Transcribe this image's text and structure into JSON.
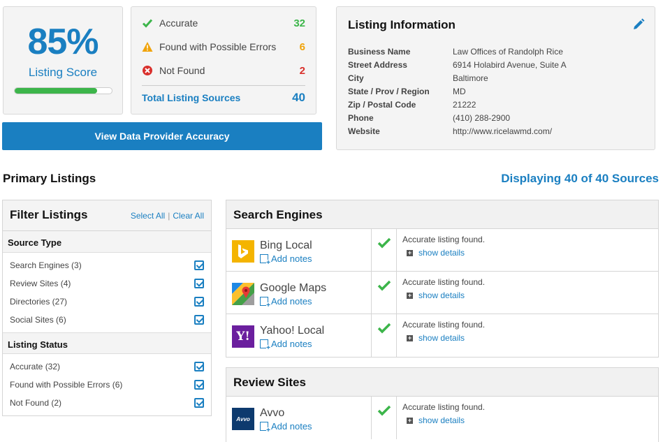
{
  "score": {
    "percent": "85%",
    "label": "Listing Score",
    "progress": 0.85
  },
  "counts": {
    "accurate": {
      "label": "Accurate",
      "value": "32",
      "color": "#3cb54a",
      "icon": "check-icon"
    },
    "errors": {
      "label": "Found with Possible Errors",
      "value": "6",
      "color": "#f0a30a",
      "icon": "warning-icon"
    },
    "not_found": {
      "label": "Not Found",
      "value": "2",
      "color": "#d9302c",
      "icon": "error-circle-icon"
    },
    "total": {
      "label": "Total Listing Sources",
      "value": "40"
    }
  },
  "provider_button": "View Data Provider Accuracy",
  "info": {
    "title": "Listing Information",
    "rows": [
      {
        "key": "Business Name",
        "value": "Law Offices of Randolph Rice"
      },
      {
        "key": "Street Address",
        "value": "6914 Holabird Avenue, Suite A"
      },
      {
        "key": "City",
        "value": "Baltimore"
      },
      {
        "key": "State / Prov / Region",
        "value": "MD"
      },
      {
        "key": "Zip / Postal Code",
        "value": "21222"
      },
      {
        "key": "Phone",
        "value": "(410) 288-2900"
      },
      {
        "key": "Website",
        "value": "http://www.ricelawmd.com/"
      }
    ]
  },
  "primary_title": "Primary Listings",
  "displaying": "Displaying 40 of 40 Sources",
  "filter": {
    "title": "Filter Listings",
    "select_all": "Select All",
    "separator": "|",
    "clear_all": "Clear All",
    "source_type": {
      "heading": "Source Type",
      "items": [
        {
          "label": "Search Engines (3)",
          "checked": true
        },
        {
          "label": "Review Sites (4)",
          "checked": true
        },
        {
          "label": "Directories (27)",
          "checked": true
        },
        {
          "label": "Social Sites (6)",
          "checked": true
        }
      ]
    },
    "listing_status": {
      "heading": "Listing Status",
      "items": [
        {
          "label": "Accurate (32)",
          "checked": true
        },
        {
          "label": "Found with Possible Errors (6)",
          "checked": true
        },
        {
          "label": "Not Found (2)",
          "checked": true
        }
      ]
    }
  },
  "groups": [
    {
      "title": "Search Engines",
      "rows": [
        {
          "name": "Bing Local",
          "notes": "Add notes",
          "status": "Accurate listing found.",
          "details": "show details",
          "logo": "bing-logo"
        },
        {
          "name": "Google Maps",
          "notes": "Add notes",
          "status": "Accurate listing found.",
          "details": "show details",
          "logo": "google-maps-logo"
        },
        {
          "name": "Yahoo! Local",
          "notes": "Add notes",
          "status": "Accurate listing found.",
          "details": "show details",
          "logo": "yahoo-logo"
        }
      ]
    },
    {
      "title": "Review Sites",
      "rows": [
        {
          "name": "Avvo",
          "notes": "Add notes",
          "status": "Accurate listing found.",
          "details": "show details",
          "logo": "avvo-logo"
        }
      ]
    }
  ],
  "logo_text": {
    "yahoo": "Y!",
    "avvo": "Avvo"
  }
}
